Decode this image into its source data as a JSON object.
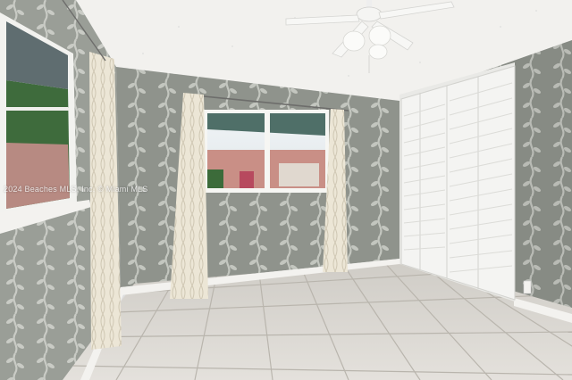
{
  "photo": {
    "watermark": "2024 Beaches MLS, Inc. © Miami MLS"
  },
  "colors": {
    "ceiling": "#f2f1ee",
    "wallpaper_base": "#8f938c",
    "wallpaper_pattern": "#c3c6bf",
    "floor_tile": "#dedbd5",
    "grout": "#b9b5ad",
    "closet_door": "#f4f4f2",
    "curtain": "#ece6d6",
    "baseboard": "#f3f2ef",
    "sky": "#e9eef2"
  },
  "icons": [
    "ceiling-fan-icon"
  ]
}
